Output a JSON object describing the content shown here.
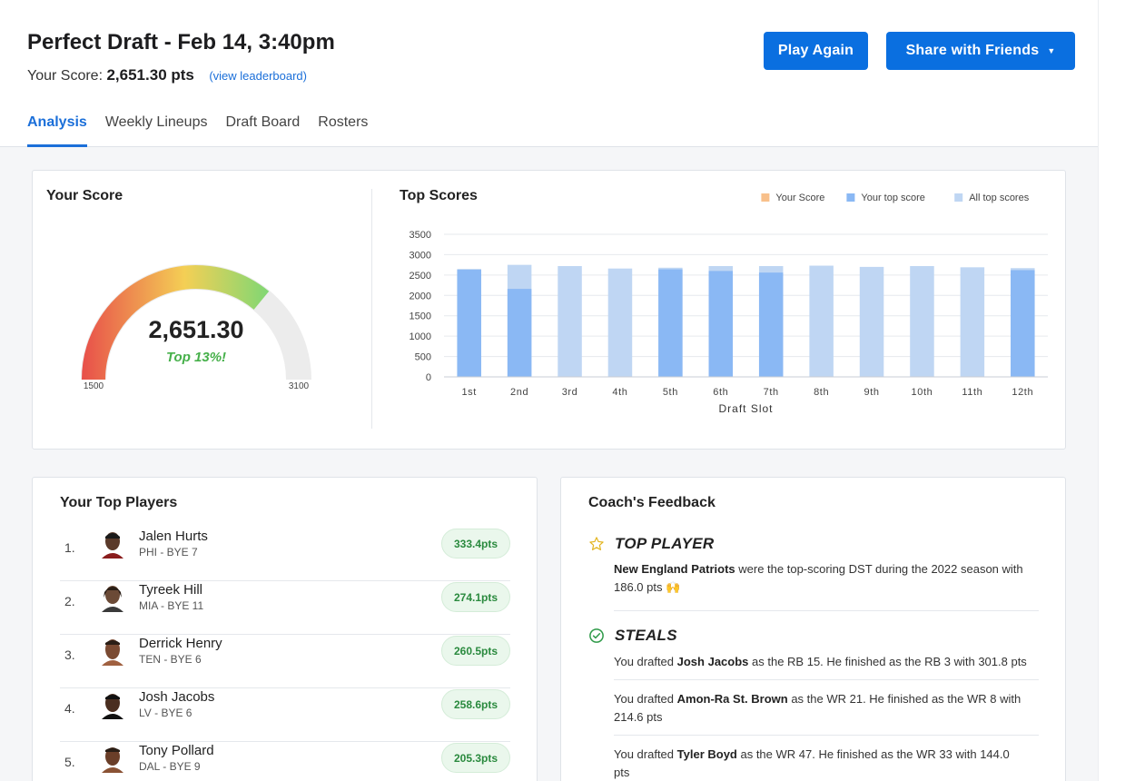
{
  "header": {
    "title": "Perfect Draft - Feb 14, 3:40pm",
    "score_label": "Your Score:",
    "score_value": "2,651.30 pts",
    "leaderboard_link": "(view leaderboard)",
    "play_again": "Play Again",
    "share": "Share with Friends"
  },
  "tabs": [
    {
      "label": "Analysis",
      "active": true
    },
    {
      "label": "Weekly Lineups",
      "active": false
    },
    {
      "label": "Draft Board",
      "active": false
    },
    {
      "label": "Rosters",
      "active": false
    }
  ],
  "your_score": {
    "title": "Your Score",
    "value": "2,651.30",
    "subtitle": "Top 13%!",
    "min_label": "1500",
    "max_label": "3100",
    "min": 1500,
    "max": 3100,
    "score": 2651.3,
    "colors": {
      "low": "#e8504a",
      "mid": "#f4cf55",
      "high": "#76d876",
      "track": "#ececec",
      "subtitle": "#46b04a"
    }
  },
  "top_scores": {
    "title": "Top Scores"
  },
  "chart_data": {
    "type": "bar",
    "title": "Top Scores",
    "xlabel": "Draft Slot",
    "ylabel": "",
    "categories": [
      "1st",
      "2nd",
      "3rd",
      "4th",
      "5th",
      "6th",
      "7th",
      "8th",
      "9th",
      "10th",
      "11th",
      "12th"
    ],
    "y_ticks": [
      "0",
      "500",
      "1000",
      "1500",
      "2000",
      "2500",
      "3000",
      "3500"
    ],
    "ylim": [
      0,
      3500
    ],
    "legend_position": "top-right",
    "series": [
      {
        "name": "Your Score",
        "color": "#f8c08b",
        "values": [
          0,
          0,
          0,
          0,
          0,
          0,
          0,
          0,
          0,
          0,
          0,
          0
        ]
      },
      {
        "name": "Your top score",
        "color": "#8ab8f4",
        "values": [
          2630,
          2160,
          null,
          null,
          2640,
          2600,
          2560,
          null,
          null,
          null,
          null,
          2620
        ]
      },
      {
        "name": "All top scores",
        "color": "#bfd6f3",
        "values": [
          2650,
          2750,
          2720,
          2660,
          2680,
          2720,
          2720,
          2730,
          2700,
          2720,
          2690,
          2670
        ]
      }
    ],
    "grid": true
  },
  "top_players": {
    "title": "Your Top Players",
    "players": [
      {
        "rank": "1.",
        "name": "Jalen Hurts",
        "meta": "PHI - BYE 7",
        "pts": "333.4pts"
      },
      {
        "rank": "2.",
        "name": "Tyreek Hill",
        "meta": "MIA - BYE 11",
        "pts": "274.1pts"
      },
      {
        "rank": "3.",
        "name": "Derrick Henry",
        "meta": "TEN - BYE 6",
        "pts": "260.5pts"
      },
      {
        "rank": "4.",
        "name": "Josh Jacobs",
        "meta": "LV - BYE 6",
        "pts": "258.6pts"
      },
      {
        "rank": "5.",
        "name": "Tony Pollard",
        "meta": "DAL - BYE 9",
        "pts": "205.3pts"
      }
    ]
  },
  "coach": {
    "title": "Coach's Feedback",
    "top_player": {
      "heading": "TOP PLAYER",
      "bold": "New England Patriots",
      "text_a": " were the top-scoring DST during the 2022 season with",
      "text_b": "186.0 pts 🙌"
    },
    "steals": {
      "heading": "STEALS",
      "items": [
        {
          "pre": "You drafted ",
          "bold": "Josh Jacobs",
          "line1": " as the RB 15. He finished as the RB 3 with 301.8 pts",
          "line2": ""
        },
        {
          "pre": "You drafted ",
          "bold": "Amon-Ra St. Brown",
          "line1": " as the WR 21. He finished as the WR 8 with",
          "line2": "214.6 pts"
        },
        {
          "pre": "You drafted ",
          "bold": "Tyler Boyd",
          "line1": " as the WR 47. He finished as the WR 33 with 144.0",
          "line2": "pts"
        }
      ]
    }
  }
}
